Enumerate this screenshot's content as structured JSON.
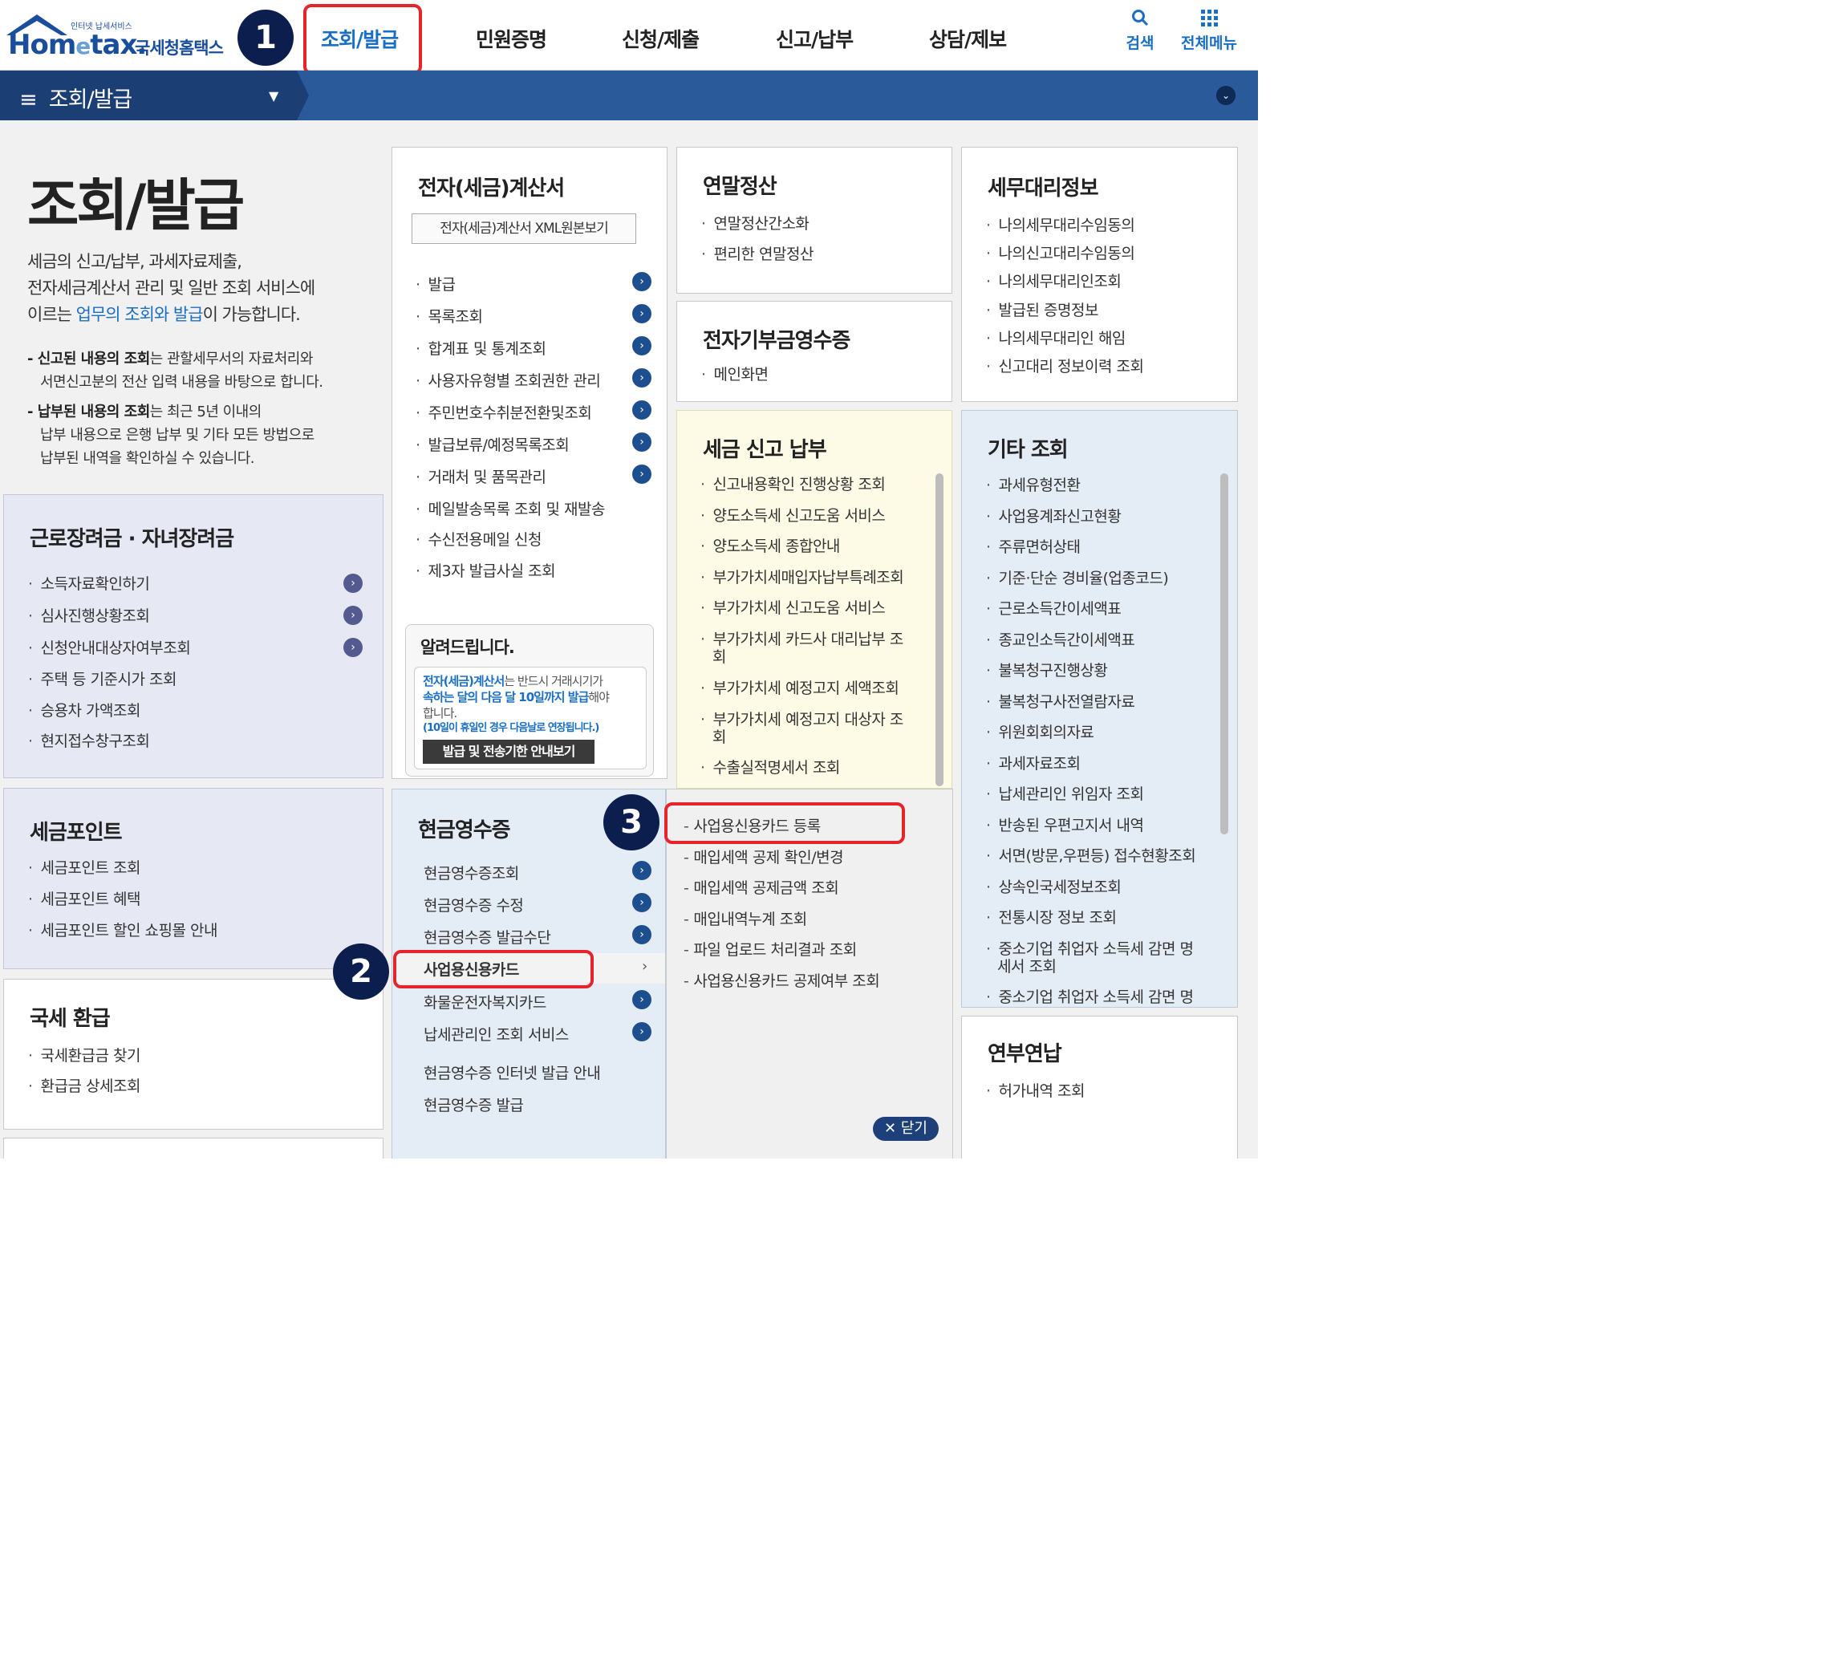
{
  "header": {
    "logo_small": "인터넷 납세서비스",
    "logo_home": "Hom",
    "logo_e": "e",
    "logo_tax": "tax.",
    "logo_nts": "국세청홈택스",
    "nav": [
      "조회/발급",
      "민원증명",
      "신청/제출",
      "신고/납부",
      "상담/제보"
    ],
    "search_label": "검색",
    "menu_label": "전체메뉴"
  },
  "subbar": {
    "label": "조회/발급"
  },
  "badges": [
    "1",
    "2",
    "3"
  ],
  "intro": {
    "title": "조회/발급",
    "line1": "세금의 신고/납부, 과세자료제출,",
    "line2": "전자세금계산서 관리 및 일반 조회 서비스에",
    "line3_pre": "이르는 ",
    "line3_blue": "업무의 조회와 발급",
    "line3_post": "이 가능합니다.",
    "note1_bold": "- 신고된 내용의 조회",
    "note1_rest": "는 관할세무서의 자료처리와",
    "note1_line2": "서면신고분의 전산 입력 내용을 바탕으로 합니다.",
    "note2_bold": "- 납부된 내용의 조회",
    "note2_rest": "는 최근 5년 이내의",
    "note2_line2": "납부 내용으로 은행 납부 및 기타 모든 방법으로",
    "note2_line3": "납부된 내역을 확인하실 수 있습니다."
  },
  "earned_income": {
    "title": "근로장려금 · 자녀장려금",
    "items": [
      "소득자료확인하기",
      "심사진행상황조회",
      "신청안내대상자여부조회",
      "주택 등 기준시가 조회",
      "승용차 가액조회",
      "현지접수창구조회"
    ]
  },
  "tax_point": {
    "title": "세금포인트",
    "items": [
      "세금포인트 조회",
      "세금포인트 혜택",
      "세금포인트 할인 쇼핑몰 안내"
    ]
  },
  "refund": {
    "title": "국세 환급",
    "items": [
      "국세환급금 찾기",
      "환급금 상세조회"
    ]
  },
  "e_invoice": {
    "title": "전자(세금)계산서",
    "xml_button": "전자(세금)계산서 XML원본보기",
    "items": [
      "발급",
      "목록조회",
      "합계표 및 통계조회",
      "사용자유형별 조회권한 관리",
      "주민번호수취분전환및조회",
      "발급보류/예정목록조회",
      "거래처 및 품목관리",
      "메일발송목록 조회 및 재발송",
      "수신전용메일 신청",
      "제3자 발급사실 조회"
    ]
  },
  "notice": {
    "title": "알려드립니다.",
    "l1_blue": "전자(세금)계산서",
    "l1_rest": "는 반드시 거래시기가",
    "l2_blue": "속하는 달의 다음 달 10일까지 발급",
    "l2_rest": "해야",
    "l3": "합니다.",
    "l4": "(10일이 휴일인 경우 다음날로 연장됩니다.)",
    "button": "발급 및 전송기한 안내보기"
  },
  "cash_receipt": {
    "title": "현금영수증",
    "items": [
      "현금영수증조회",
      "현금영수증 수정",
      "현금영수증 발급수단",
      "사업용신용카드",
      "화물운전자복지카드",
      "납세관리인 조회 서비스",
      "현금영수증 인터넷 발급 안내",
      "현금영수증 발급"
    ],
    "selected_arrow": "›"
  },
  "submenu": {
    "items": [
      "사업용신용카드 등록",
      "매입세액 공제 확인/변경",
      "매입세액 공제금액 조회",
      "매입내역누계 조회",
      "파일 업로드 처리결과 조회",
      "사업용신용카드 공제여부 조회"
    ],
    "close": "✕ 닫기"
  },
  "year_end": {
    "title": "연말정산",
    "items": [
      "연말정산간소화",
      "편리한 연말정산"
    ]
  },
  "donation": {
    "title": "전자기부금영수증",
    "items": [
      "메인화면"
    ]
  },
  "tax_report": {
    "title": "세금 신고 납부",
    "items": [
      "신고내용확인 진행상황 조회",
      "양도소득세 신고도움 서비스",
      "양도소득세 종합안내",
      "부가가치세매입자납부특례조회",
      "부가가치세 신고도움 서비스",
      "부가가치세 카드사 대리납부 조",
      "회",
      "부가가치세 예정고지 세액조회",
      "부가가치세 예정고지 대상자 조",
      "회",
      "수출실적명세서 조회"
    ]
  },
  "agent": {
    "title": "세무대리정보",
    "items": [
      "나의세무대리수임동의",
      "나의신고대리수임동의",
      "나의세무대리인조회",
      "발급된 증명정보",
      "나의세무대리인 해임",
      "신고대리 정보이력 조회"
    ]
  },
  "other": {
    "title": "기타 조회",
    "items": [
      "과세유형전환",
      "사업용계좌신고현황",
      "주류면허상태",
      "기준·단순 경비율(업종코드)",
      "근로소득간이세액표",
      "종교인소득간이세액표",
      "불복청구진행상황",
      "불복청구사전열람자료",
      "위원회회의자료",
      "과세자료조회",
      "납세관리인 위임자 조회",
      "반송된 우편고지서 내역",
      "서면(방문,우편등) 접수현황조회",
      "상속인국세정보조회",
      "전통시장 정보 조회",
      "중소기업 취업자 소득세 감면 명",
      "세서 조회",
      "중소기업 취업자 소득세 감면 명"
    ]
  },
  "deferral": {
    "title": "연부연납",
    "items": [
      "허가내역 조회"
    ]
  },
  "colors": {
    "accent_red": "#e5242b",
    "badge_navy": "#0b1e4d",
    "nav_active": "#1a6fc4",
    "subbar_bg": "#2a5a9a"
  },
  "icons": {
    "search": "search-icon",
    "menu": "grid-menu-icon",
    "hamburger": "hamburger-icon",
    "arrow": "circle-arrow-icon"
  }
}
